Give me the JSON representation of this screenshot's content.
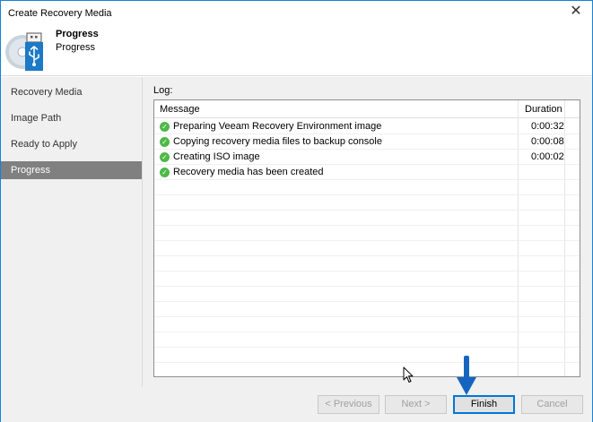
{
  "window": {
    "title": "Create Recovery Media",
    "close_glyph": "✕"
  },
  "header": {
    "title": "Progress",
    "subtitle": "Progress",
    "icon": "usb-disc-icon"
  },
  "sidebar": {
    "items": [
      {
        "label": "Recovery Media",
        "active": false
      },
      {
        "label": "Image Path",
        "active": false
      },
      {
        "label": "Ready to Apply",
        "active": false
      },
      {
        "label": "Progress",
        "active": true
      }
    ]
  },
  "log": {
    "label": "Log:",
    "columns": {
      "message": "Message",
      "duration": "Duration"
    },
    "rows": [
      {
        "status": "success",
        "message": "Preparing Veeam Recovery Environment image",
        "duration": "0:00:32"
      },
      {
        "status": "success",
        "message": "Copying recovery media files to backup console",
        "duration": "0:00:08"
      },
      {
        "status": "success",
        "message": "Creating ISO image",
        "duration": "0:00:02"
      },
      {
        "status": "success",
        "message": "Recovery media has been created",
        "duration": ""
      }
    ]
  },
  "footer": {
    "previous_label": "< Previous",
    "next_label": "Next >",
    "finish_label": "Finish",
    "cancel_label": "Cancel"
  },
  "colors": {
    "accent": "#0078d7",
    "active_step": "#808080",
    "success": "#4fb848",
    "annotation_arrow": "#1565c0"
  }
}
